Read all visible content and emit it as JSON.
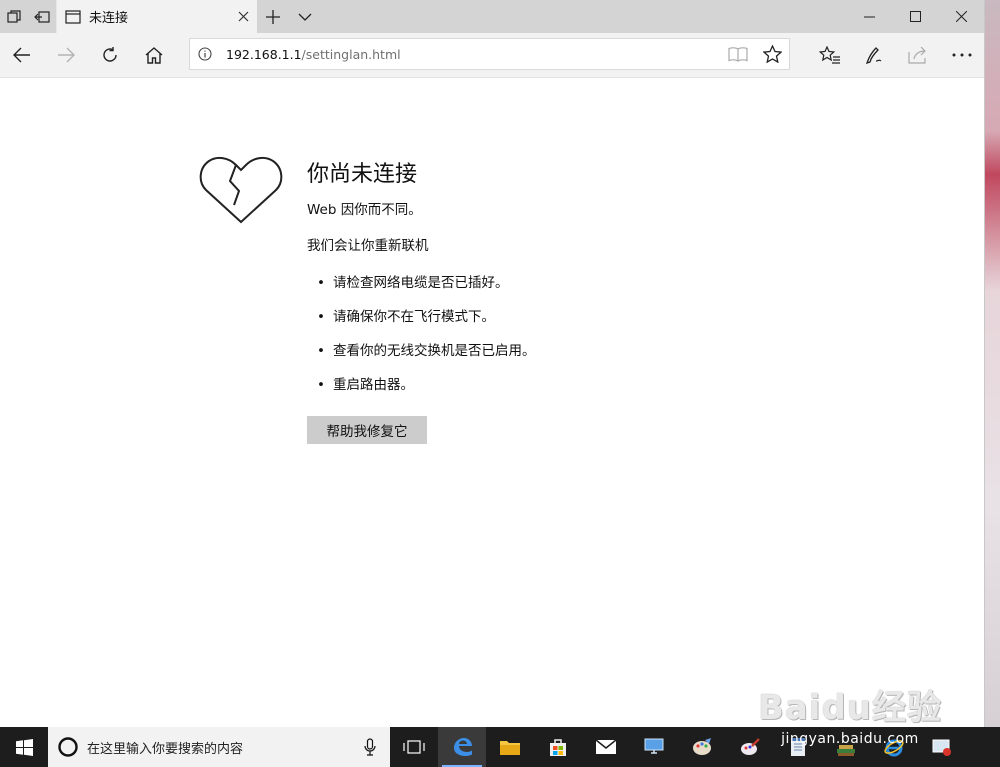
{
  "browser": {
    "tab_title": "未连接",
    "address_host": "192.168.1.1",
    "address_path": "/settinglan.html"
  },
  "page": {
    "heading": "你尚未连接",
    "line1": "Web 因你而不同。",
    "line2": "我们会让你重新联机",
    "tips": [
      "请检查网络电缆是否已插好。",
      "请确保你不在飞行模式下。",
      "查看你的无线交换机是否已启用。",
      "重启路由器。"
    ],
    "help_button": "帮助我修复它"
  },
  "taskbar": {
    "search_placeholder": "在这里输入你要搜索的内容"
  },
  "watermark": {
    "logo": "Baidu经验",
    "url": "jingyan.baidu.com"
  },
  "colors": {
    "accent": "#0063b1",
    "taskbar": "#1d1d1d",
    "button": "#cccccc"
  }
}
